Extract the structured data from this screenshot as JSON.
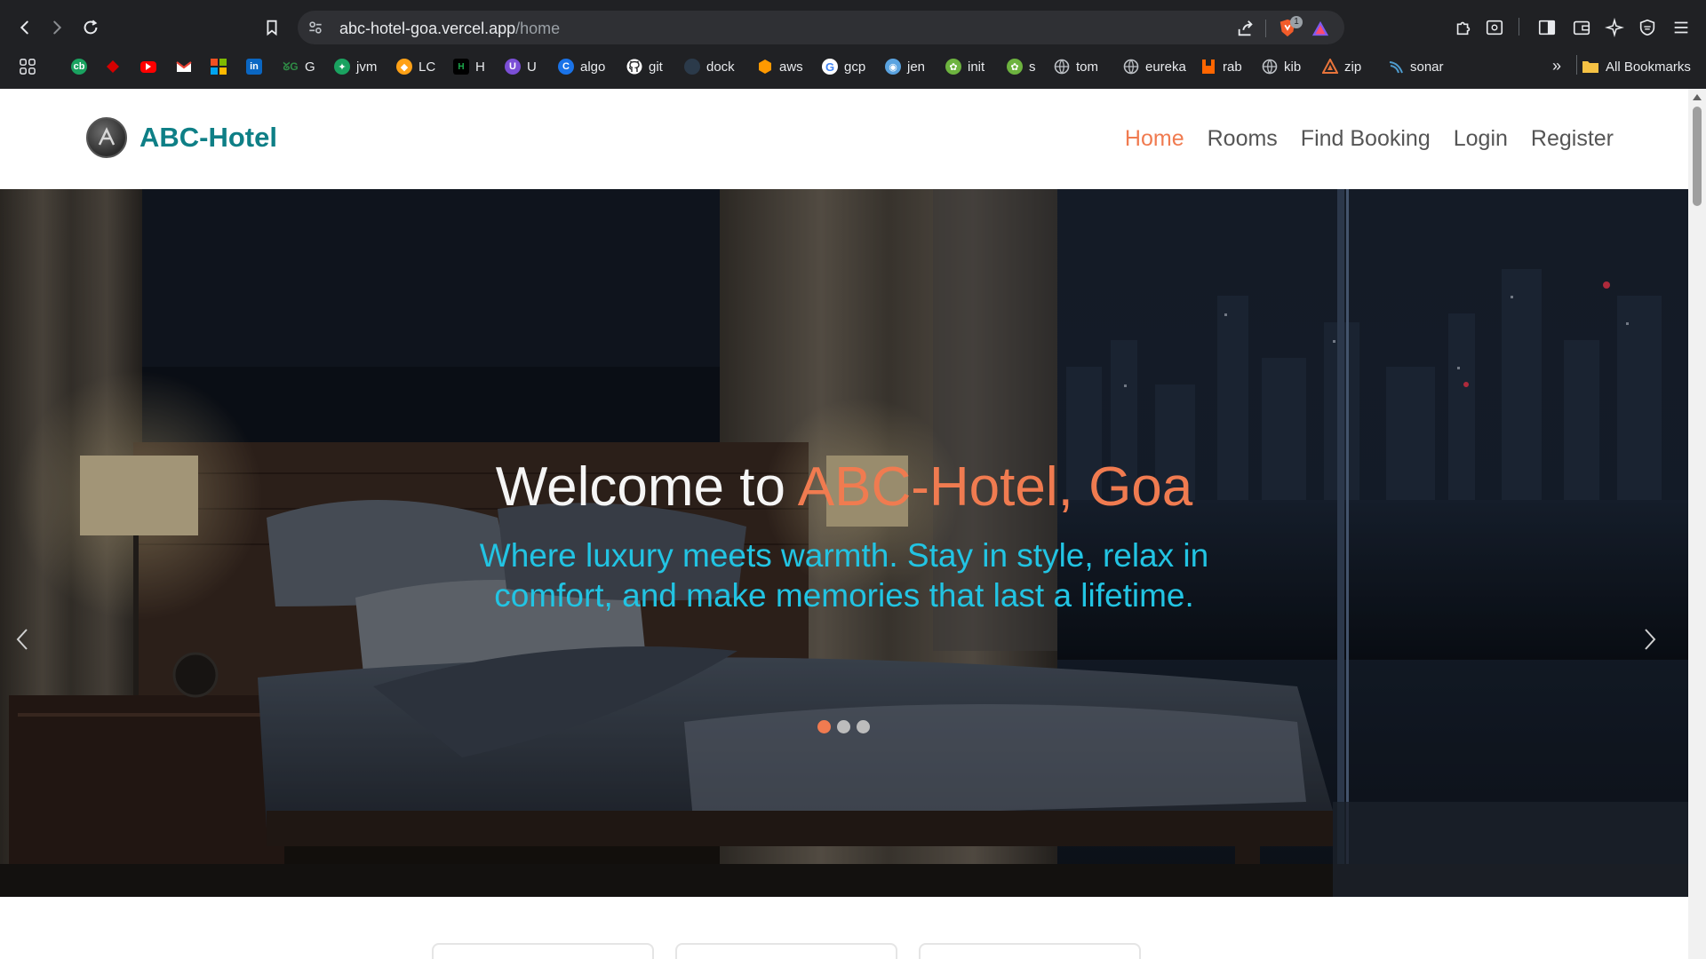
{
  "browser": {
    "url_host": "abc-hotel-goa.vercel.app",
    "url_path": "/home",
    "bookmarks": [
      {
        "label": "",
        "icon": "apps-grid-icon"
      },
      {
        "label": "",
        "icon": "cb-icon",
        "color": "#1aa260"
      },
      {
        "label": "",
        "icon": "diamond-icon",
        "color": "#d50000"
      },
      {
        "label": "",
        "icon": "youtube-icon",
        "color": "#ff0000"
      },
      {
        "label": "",
        "icon": "gmail-icon",
        "color": "#ea4335"
      },
      {
        "label": "",
        "icon": "microsoft-icon"
      },
      {
        "label": "",
        "icon": "linkedin-icon",
        "color": "#0a66c2"
      },
      {
        "label": "G",
        "icon": "gfg-icon",
        "color": "#2f8d46"
      },
      {
        "label": "jvm",
        "icon": "jvm-icon",
        "color": "#1aa260"
      },
      {
        "label": "LC",
        "icon": "leetcode-icon",
        "color": "#ffa116"
      },
      {
        "label": "H",
        "icon": "hackerrank-icon",
        "color": "#000000"
      },
      {
        "label": "U",
        "icon": "u-icon",
        "color": "#7b4fd6"
      },
      {
        "label": "algo",
        "icon": "c-icon",
        "color": "#1a73e8"
      },
      {
        "label": "git",
        "icon": "github-icon",
        "color": "#ffffff"
      },
      {
        "label": "dock",
        "icon": "docker-icon",
        "color": "#2b3a4a"
      },
      {
        "label": "aws",
        "icon": "aws-icon",
        "color": "#ff9900"
      },
      {
        "label": "gcp",
        "icon": "google-icon",
        "color": "#ffffff"
      },
      {
        "label": "jen",
        "icon": "jenkins-icon",
        "color": "#5aa3e0"
      },
      {
        "label": "init",
        "icon": "spring-icon",
        "color": "#6db33f"
      },
      {
        "label": "s",
        "icon": "spring-icon",
        "color": "#6db33f"
      },
      {
        "label": "tom",
        "icon": "globe-icon",
        "color": "#9aa0a6"
      },
      {
        "label": "eureka",
        "icon": "globe-icon",
        "color": "#9aa0a6"
      },
      {
        "label": "rab",
        "icon": "rabbitmq-icon",
        "color": "#ff6600"
      },
      {
        "label": "kib",
        "icon": "kibana-icon",
        "color": "#9aa0a6"
      },
      {
        "label": "zip",
        "icon": "zipkin-icon",
        "color": "#e8743b"
      },
      {
        "label": "sonar",
        "icon": "sonar-icon",
        "color": "#4e9bcd"
      }
    ],
    "all_bookmarks": "All Bookmarks",
    "shield_badge": "1"
  },
  "site": {
    "brand": "ABC-Hotel",
    "nav": [
      {
        "label": "Home",
        "active": true
      },
      {
        "label": "Rooms",
        "active": false
      },
      {
        "label": "Find Booking",
        "active": false
      },
      {
        "label": "Login",
        "active": false
      },
      {
        "label": "Register",
        "active": false
      }
    ],
    "hero": {
      "title_prefix": "Welcome to ",
      "title_accent": "ABC-Hotel, Goa",
      "subtitle": "Where luxury meets warmth. Stay in style, relax in comfort, and make memories that last a lifetime.",
      "slides_total": 3,
      "active_slide": 1
    }
  },
  "colors": {
    "accent": "#f07b50",
    "brand": "#0e7f86",
    "subtitle": "#22c4e3"
  }
}
